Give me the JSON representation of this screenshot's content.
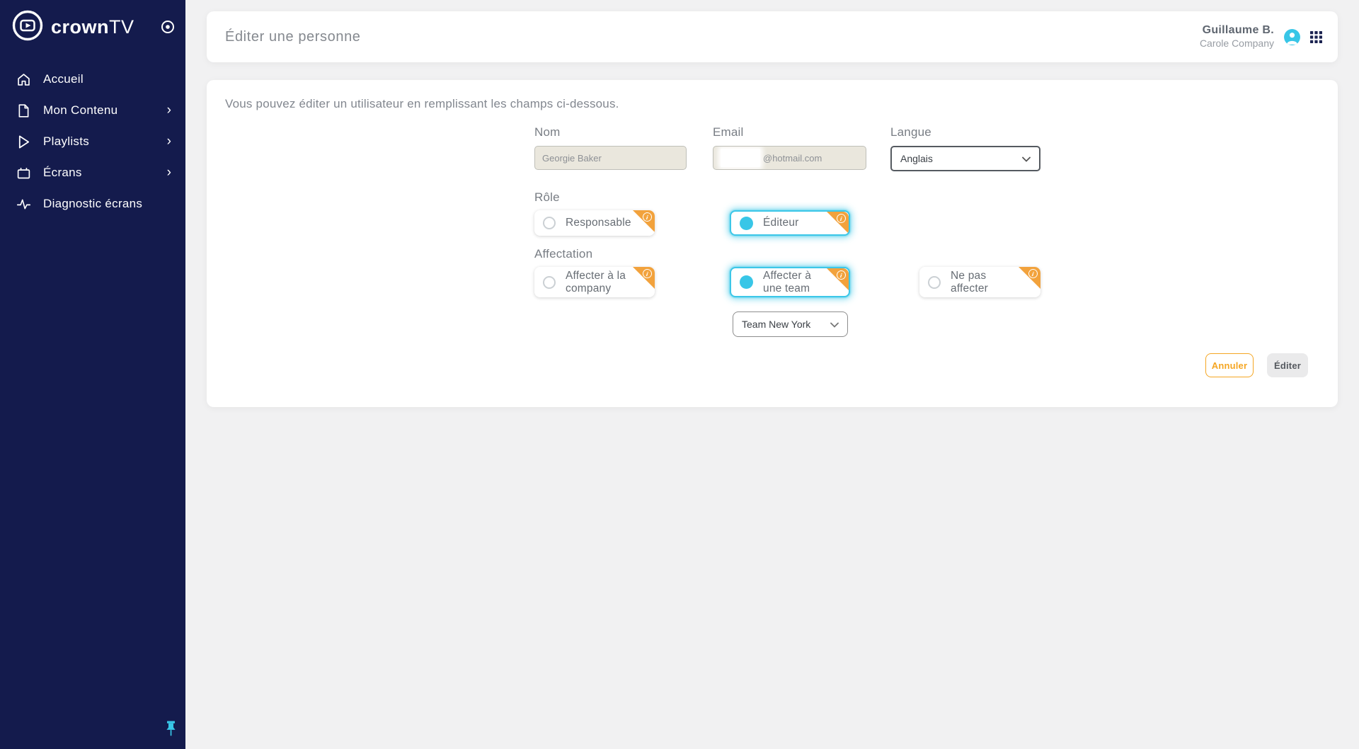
{
  "brand": {
    "part1": "crown",
    "part2": "TV"
  },
  "sidebar": {
    "items": [
      {
        "label": "Accueil",
        "icon": "home-icon",
        "chevron": ""
      },
      {
        "label": "Mon Contenu",
        "icon": "document-icon",
        "chevron": "›"
      },
      {
        "label": "Playlists",
        "icon": "play-icon",
        "chevron": "›"
      },
      {
        "label": "Écrans",
        "icon": "tv-icon",
        "chevron": "›"
      },
      {
        "label": "Diagnostic écrans",
        "icon": "pulse-icon",
        "chevron": ""
      }
    ]
  },
  "header": {
    "title": "Éditer une personne",
    "user_name": "Guillaume B.",
    "user_company": "Carole Company"
  },
  "main": {
    "intro": "Vous pouvez éditer un utilisateur en remplissant les champs ci-dessous.",
    "fields": {
      "nom": {
        "label": "Nom",
        "value": "Georgie Baker"
      },
      "email": {
        "label": "Email",
        "value_visible": "@hotmail.com"
      },
      "langue": {
        "label": "Langue",
        "value": "Anglais"
      }
    },
    "role": {
      "label": "Rôle",
      "options": [
        {
          "label": "Responsable",
          "selected": false
        },
        {
          "label": "Éditeur",
          "selected": true
        }
      ]
    },
    "affectation": {
      "label": "Affectation",
      "options": [
        {
          "label": "Affecter à la company",
          "selected": false
        },
        {
          "label": "Affecter à une team",
          "selected": true
        },
        {
          "label": "Ne pas affecter",
          "selected": false
        }
      ]
    },
    "team": {
      "value": "Team New York"
    },
    "buttons": {
      "cancel": "Annuler",
      "submit": "Éditer"
    }
  },
  "colors": {
    "sidebar_bg": "#141b4d",
    "accent_cyan": "#38c6e7",
    "accent_orange": "#f2a23c",
    "cancel_orange": "#f5a623",
    "page_bg": "#f1f1f2"
  }
}
